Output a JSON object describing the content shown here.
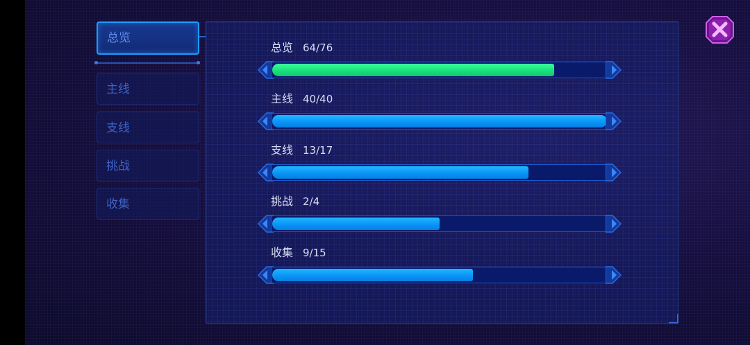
{
  "sidebar": {
    "tabs": [
      {
        "label": "总览",
        "active": true
      },
      {
        "label": "主线",
        "active": false
      },
      {
        "label": "支线",
        "active": false
      },
      {
        "label": "挑战",
        "active": false
      },
      {
        "label": "收集",
        "active": false
      }
    ]
  },
  "progress": [
    {
      "label": "总览",
      "count": "64/76",
      "fraction": 0.842,
      "color": "#16e07a"
    },
    {
      "label": "主线",
      "count": "40/40",
      "fraction": 1.0,
      "color": "#0a92f5"
    },
    {
      "label": "支线",
      "count": "13/17",
      "fraction": 0.765,
      "color": "#0a92f5"
    },
    {
      "label": "挑战",
      "count": "2/4",
      "fraction": 0.5,
      "color": "#0a92f5"
    },
    {
      "label": "收集",
      "count": "9/15",
      "fraction": 0.6,
      "color": "#0a92f5"
    }
  ],
  "close_icon": "close-x-icon"
}
